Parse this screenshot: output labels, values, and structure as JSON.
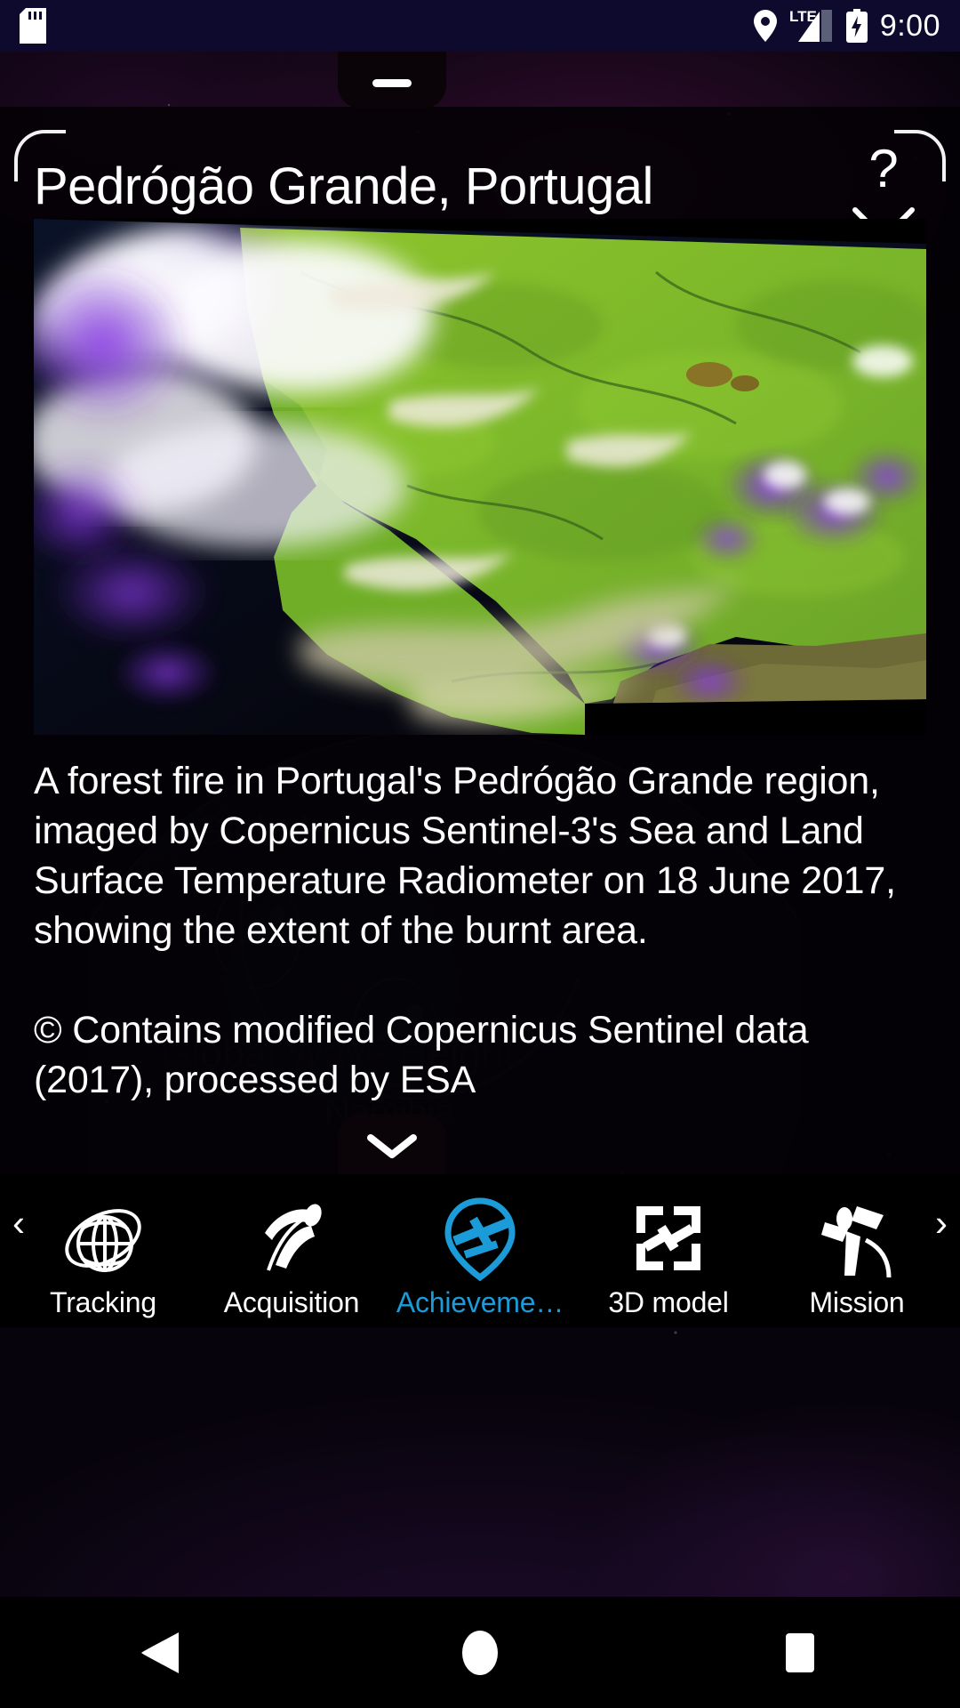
{
  "status_bar": {
    "sd_card_icon": "sd-card-icon",
    "location_icon": "location-pin-icon",
    "network_label": "LTE",
    "signal_icon": "signal-bars-icon",
    "battery_icon": "battery-charging-icon",
    "time": "9:00"
  },
  "card": {
    "title": "Pedrógão Grande, Portugal",
    "help_label": "?",
    "collapse_icon": "collapse-arrows-icon",
    "drag_handle_top_icon": "drag-handle-icon",
    "drag_handle_bottom_icon": "chevron-down-icon",
    "image_name": "sentinel-3-slstr-portugal-wildfire-image",
    "description": "A forest fire in Portugal's Pedrógão Grande region, imaged by Copernicus Sentinel-3's Sea and Land Surface Temperature Radiometer on 18 June 2017, showing the extent of the burnt area.",
    "credit": "© Contains modified Copernicus Sentinel data (2017), processed by ESA"
  },
  "background_watermarks": {
    "label_1": "Global Land Temperature",
    "label_2": "Global Wave Height",
    "label_3": "Namibia"
  },
  "bottom_nav": {
    "prev_arrow": "‹",
    "next_arrow": "›",
    "active_index": 2,
    "accent_color": "#1b9bd8",
    "items": [
      {
        "label": "Tracking",
        "icon": "globe-orbit-icon"
      },
      {
        "label": "Acquisition",
        "icon": "satellite-swath-icon"
      },
      {
        "label": "Achieveme…",
        "icon": "map-pin-satellite-icon"
      },
      {
        "label": "3D model",
        "icon": "satellite-frame-icon"
      },
      {
        "label": "Mission",
        "icon": "satellite-antenna-icon"
      }
    ]
  },
  "system_nav": {
    "back_icon": "back-triangle-icon",
    "home_icon": "home-circle-icon",
    "recents_icon": "recents-square-icon"
  }
}
